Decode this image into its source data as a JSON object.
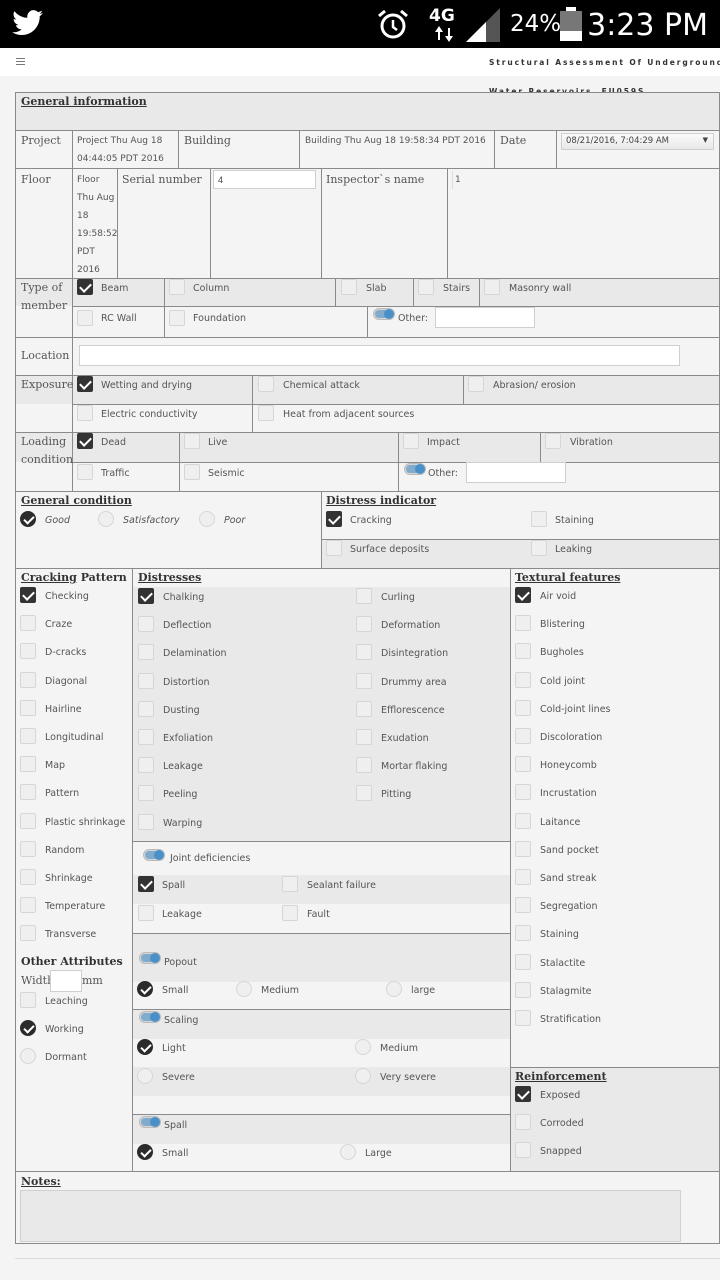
{
  "status": {
    "time": "3:23 PM",
    "battery": "24%",
    "network": "4G"
  },
  "header": {
    "title_line1": "Structural Assessment Of Underground",
    "title_line2": "Water Reservoirs, EU059S"
  },
  "general": {
    "title": "General information",
    "project_label": "Project",
    "project_value": "Project Thu Aug 18 04:44:05 PDT 2016",
    "building_label": "Building",
    "building_value": "Building Thu Aug 18 19:58:34 PDT 2016",
    "date_label": "Date",
    "date_value": "08/21/2016, 7:04:29 AM",
    "floor_label": "Floor",
    "floor_value": "Floor Thu Aug 18 19:58:52 PDT 2016",
    "serial_label": "Serial number",
    "serial_value": "4",
    "inspector_label": "Inspector`s name",
    "inspector_value": "1"
  },
  "member": {
    "label": "Type of member",
    "beam": "Beam",
    "column": "Column",
    "slab": "Slab",
    "stairs": "Stairs",
    "masonry": "Masonry wall",
    "rcwall": "RC Wall",
    "foundation": "Foundation",
    "other": "Other:"
  },
  "location": {
    "label": "Location"
  },
  "exposure": {
    "label": "Exposure",
    "wet": "Wetting and drying",
    "chem": "Chemical attack",
    "abrasion": "Abrasion/ erosion",
    "elec": "Electric conductivity",
    "heat": "Heat from adjacent sources"
  },
  "loading": {
    "label": "Loading condition",
    "dead": "Dead",
    "live": "Live",
    "impact": "Impact",
    "vibration": "Vibration",
    "traffic": "Traffic",
    "seismic": "Seismic",
    "other": "Other:"
  },
  "condition": {
    "title": "General condition",
    "good": "Good",
    "satisfactory": "Satisfactory",
    "poor": "Poor"
  },
  "distress_ind": {
    "title": "Distress indicator",
    "cracking": "Cracking",
    "staining": "Staining",
    "surface": "Surface deposits",
    "leaking": "Leaking"
  },
  "cracking": {
    "title_u": "Cracking",
    "title_rest": " Pattern",
    "items": [
      "Checking",
      "Craze",
      "D-cracks",
      "Diagonal",
      "Hairline",
      "Longitudinal",
      "Map",
      "Pattern",
      "Plastic shrinkage",
      "Random",
      "Shrinkage",
      "Temperature",
      "Transverse"
    ]
  },
  "other_attr": {
    "title": "Other Attributes",
    "width": "Width",
    "mm": "mm",
    "leaching": "Leaching",
    "working": "Working",
    "dormant": "Dormant"
  },
  "distresses": {
    "title": "Distresses",
    "left": [
      "Chalking",
      "Deflection",
      "Delamination",
      "Distortion",
      "Dusting",
      "Exfoliation",
      "Leakage",
      "Peeling",
      "Warping"
    ],
    "right": [
      "Curling",
      "Deformation",
      "Disintegration",
      "Drummy area",
      "Efflorescence",
      "Exudation",
      "Mortar flaking",
      "Pitting"
    ]
  },
  "joint": {
    "title": "Joint deficiencies",
    "spall": "Spall",
    "sealant": "Sealant failure",
    "leakage": "Leakage",
    "fault": "Fault"
  },
  "popout": {
    "title": "Popout",
    "small": "Small",
    "medium": "Medium",
    "large": "large"
  },
  "scaling": {
    "title": "Scaling",
    "light": "Light",
    "medium": "Medium",
    "severe": "Severe",
    "very_severe": "Very severe"
  },
  "spall": {
    "title": "Spall",
    "small": "Small",
    "large": "Large"
  },
  "textural": {
    "title": "Textural features",
    "items": [
      "Air void",
      "Blistering",
      "Bugholes",
      "Cold joint",
      "Cold-joint lines",
      "Discoloration",
      "Honeycomb",
      "Incrustation",
      "Laitance",
      "Sand pocket",
      "Sand streak",
      "Segregation",
      "Staining",
      "Stalactite",
      "Stalagmite",
      "Stratification"
    ]
  },
  "reinforcement": {
    "title": "Reinforcement",
    "exposed": "Exposed",
    "corroded": "Corroded",
    "snapped": "Snapped"
  },
  "notes": {
    "title": "Notes:"
  }
}
